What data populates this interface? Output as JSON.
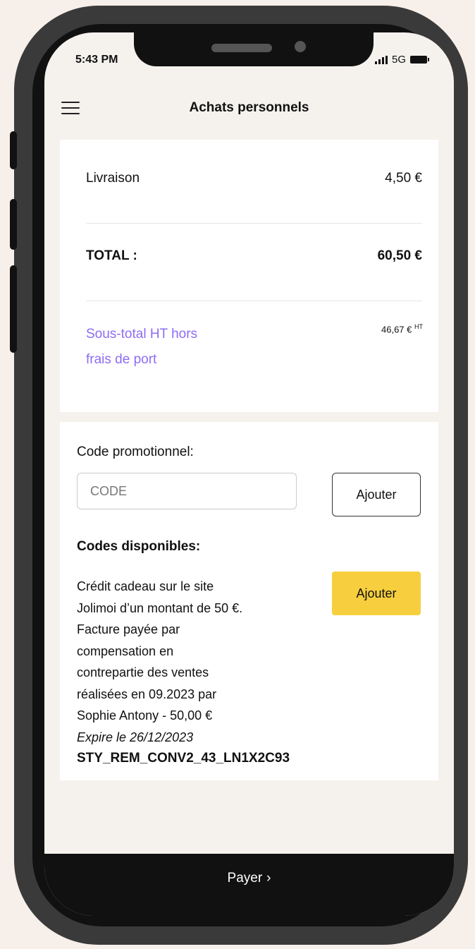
{
  "status": {
    "time": "5:43 PM",
    "network": "5G"
  },
  "header": {
    "title": "Achats personnels"
  },
  "summary": {
    "livraison_label": "Livraison",
    "livraison_value": "4,50 €",
    "total_label": "TOTAL :",
    "total_value": "60,50 €",
    "subtotal_label_line1": "Sous-total HT hors",
    "subtotal_label_line2": "frais de port",
    "subtotal_value": "46,67 €",
    "subtotal_suffix": "HT"
  },
  "promo": {
    "label": "Code promotionnel:",
    "placeholder": "CODE",
    "add_label": "Ajouter"
  },
  "available_codes": {
    "title": "Codes disponibles:",
    "items": [
      {
        "lines": [
          "Crédit cadeau sur le site",
          "Jolimoi d’un montant de 50 €.",
          "Facture payée par",
          "compensation en",
          "contrepartie des ventes",
          "réalisées en 09.2023 par",
          "Sophie Antony - 50,00 €"
        ],
        "expiry": "Expire le 26/12/2023",
        "code": "STY_REM_CONV2_43_LN1X2C93",
        "button_label": "Ajouter"
      }
    ]
  },
  "footer": {
    "pay_label": "Payer",
    "chevron": "›"
  },
  "colors": {
    "accent_purple": "#8e6cf5",
    "button_yellow": "#f7cf3e",
    "pay_bar": "#111111"
  }
}
